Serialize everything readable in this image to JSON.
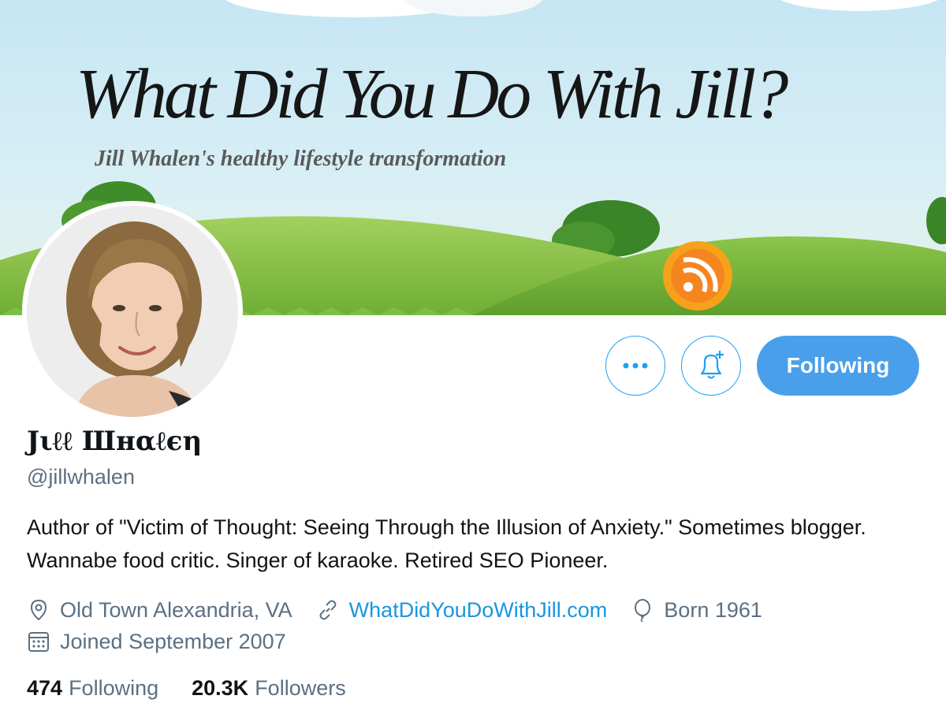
{
  "banner": {
    "title": "What Did You Do With Jill?",
    "tagline": "Jill Whalen's healthy lifestyle transformation",
    "rss_icon": "rss-icon"
  },
  "profile": {
    "display_name": "Jιℓℓ Шнαℓєη",
    "handle": "@jillwhalen",
    "bio": "Author of \"Victim of Thought: Seeing Through the Illusion of Anxiety.\" Sometimes blogger. Wannabe food critic. Singer of karaoke. Retired SEO Pioneer.",
    "location": "Old Town Alexandria, VA",
    "website": "WhatDidYouDoWithJill.com",
    "birth": "Born 1961",
    "joined": "Joined September 2007"
  },
  "actions": {
    "more_icon": "more-dots-icon",
    "notify_icon": "bell-plus-icon",
    "following_label": "Following"
  },
  "stats": {
    "following_count": "474",
    "following_label": "Following",
    "followers_count": "20.3K",
    "followers_label": "Followers"
  },
  "colors": {
    "accent": "#1da1f2",
    "following_button": "#4a9fea",
    "link": "#1b95e0",
    "secondary_text": "#5b7083"
  }
}
